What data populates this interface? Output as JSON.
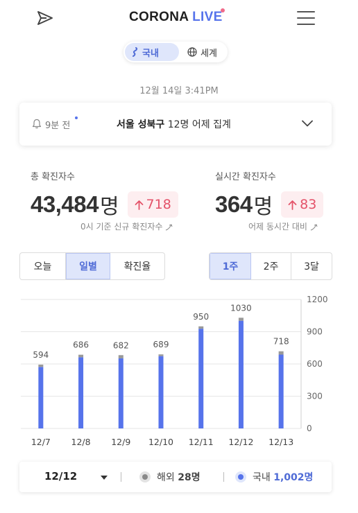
{
  "header": {
    "logo_main": "CORONA ",
    "logo_accent": "LIVE"
  },
  "region": {
    "domestic": "국내",
    "world": "세계"
  },
  "timestamp": "12월 14일 3:41PM",
  "notice": {
    "time": "9분 전",
    "location": "서울 성북구",
    "message": " 12명 어제 집계"
  },
  "stats": {
    "total": {
      "label": "총 확진자수",
      "value": "43,484",
      "unit": "명",
      "delta": "718",
      "caption": "0시 기준 신규 확진자수"
    },
    "realtime": {
      "label": "실시간 확진자수",
      "value": "364",
      "unit": "명",
      "delta": "83",
      "caption": "어제 동시간 대비"
    }
  },
  "view_tabs": [
    "오늘",
    "일별",
    "확진율"
  ],
  "view_active": 1,
  "range_tabs": [
    "1주",
    "2주",
    "3달"
  ],
  "range_active": 0,
  "colors": {
    "domestic_bar": "#5673eb",
    "overseas_bar": "#999999",
    "accent": "#5673eb",
    "delta_red": "#e45269"
  },
  "chart_data": {
    "type": "bar",
    "stacked": true,
    "categories": [
      "12/7",
      "12/8",
      "12/9",
      "12/10",
      "12/11",
      "12/12",
      "12/13"
    ],
    "totals": [
      594,
      686,
      682,
      689,
      950,
      1030,
      718
    ],
    "series": [
      {
        "name": "해외",
        "values": [
          22,
          24,
          30,
          16,
          22,
          28,
          31
        ]
      },
      {
        "name": "국내",
        "values": [
          572,
          662,
          652,
          673,
          928,
          1002,
          687
        ]
      }
    ],
    "y_ticks": [
      0,
      300,
      600,
      900,
      1200
    ],
    "ylim": [
      0,
      1200
    ],
    "y_axis_side": "right",
    "grid": true
  },
  "summary": {
    "date": "12/12",
    "overseas_label": "해외 ",
    "overseas_value": "28명",
    "domestic_label": "국내 ",
    "domestic_value": "1,002명"
  }
}
